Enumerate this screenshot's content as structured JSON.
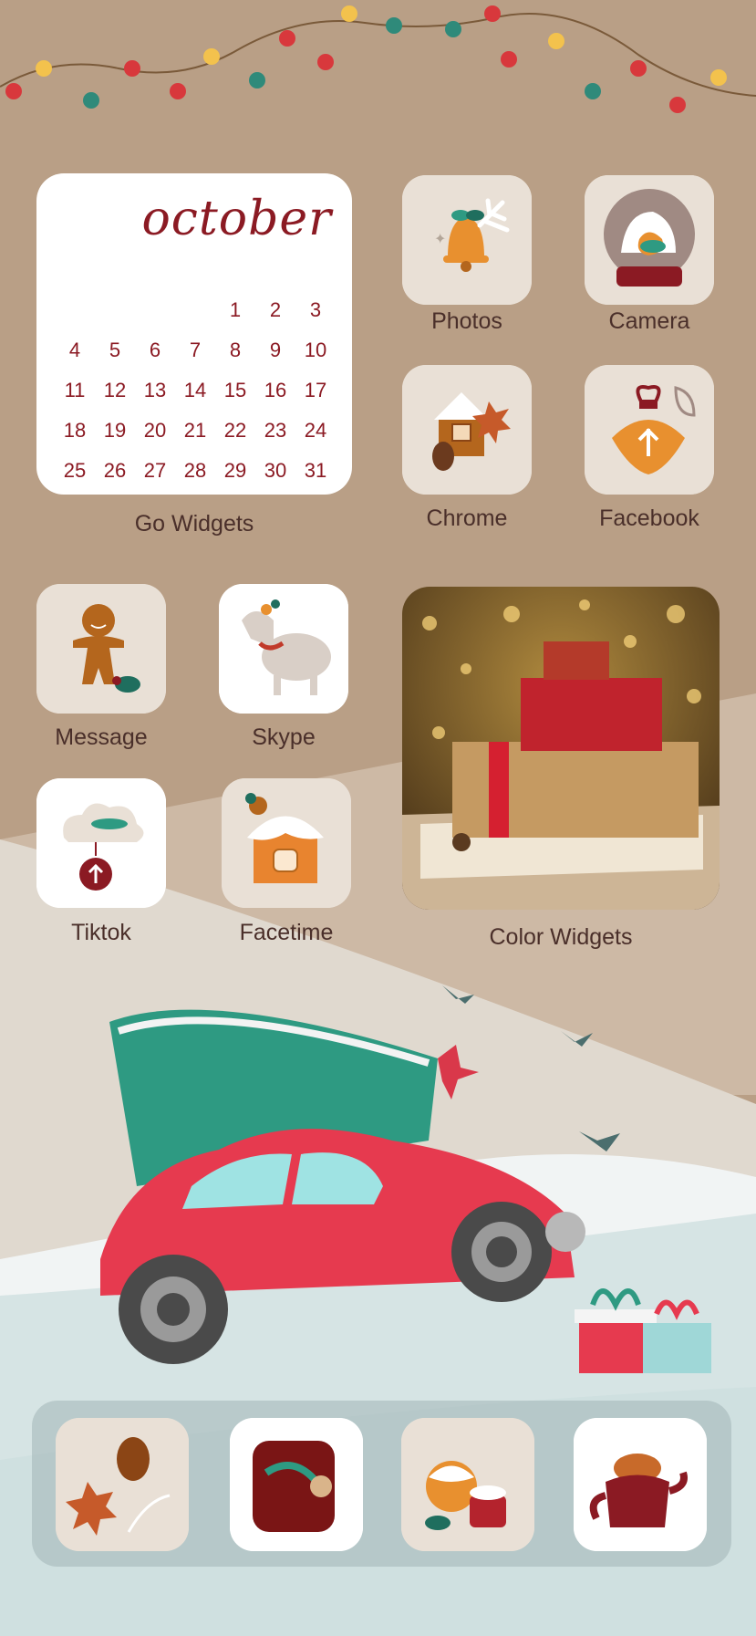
{
  "calendar_widget": {
    "month": "october",
    "days": [
      [
        "",
        "",
        "",
        "",
        "1",
        "2",
        "3"
      ],
      [
        "4",
        "5",
        "6",
        "7",
        "8",
        "9",
        "10"
      ],
      [
        "11",
        "12",
        "13",
        "14",
        "15",
        "16",
        "17"
      ],
      [
        "18",
        "19",
        "20",
        "21",
        "22",
        "23",
        "24"
      ],
      [
        "25",
        "26",
        "27",
        "28",
        "29",
        "30",
        "31"
      ]
    ],
    "label": "Go Widgets"
  },
  "apps": {
    "photos": "Photos",
    "camera": "Camera",
    "chrome": "Chrome",
    "facebook": "Facebook",
    "message": "Message",
    "skype": "Skype",
    "tiktok": "Tiktok",
    "facetime": "Facetime"
  },
  "photo_widget": {
    "label": "Color Widgets"
  },
  "icons": {
    "photos": "christmas-bell-icon",
    "camera": "snow-globe-icon",
    "chrome": "gingerbread-house-icon",
    "facebook": "ornament-icon",
    "message": "gingerbread-man-icon",
    "skype": "reindeer-icon",
    "tiktok": "cloud-ornament-icon",
    "facetime": "snowy-house-icon",
    "dock": [
      "pinecone-cookie-icon",
      "gift-box-icon",
      "pudding-cocoa-icon",
      "teapot-icon"
    ]
  },
  "colors": {
    "background": "#b99f86",
    "accent": "#8b1a23",
    "label": "#4a2f2a"
  }
}
